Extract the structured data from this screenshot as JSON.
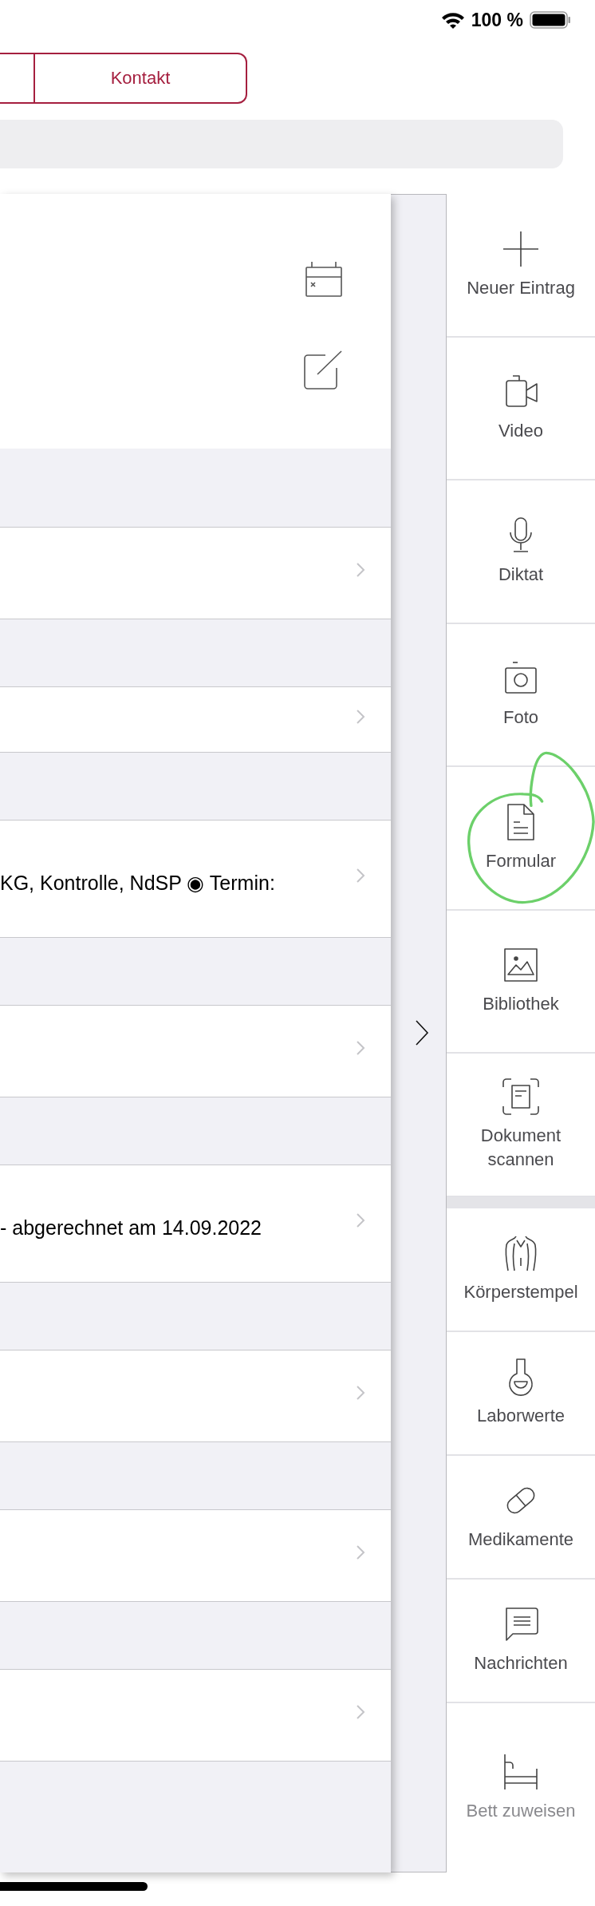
{
  "status_bar": {
    "battery_text": "100 %"
  },
  "segmented_control": {
    "segments": [
      {
        "label": "Kontakt",
        "selected": false
      }
    ]
  },
  "entries": [
    {
      "kind": "row"
    },
    {
      "kind": "row"
    },
    {
      "kind": "row",
      "text": "KG, Kontrolle, NdSP ◉ Termin:"
    },
    {
      "kind": "row"
    },
    {
      "kind": "row",
      "text": "- abgerechnet am 14.09.2022"
    },
    {
      "kind": "row"
    },
    {
      "kind": "row"
    },
    {
      "kind": "row"
    }
  ],
  "actions": {
    "groups": [
      [
        {
          "label": "Neuer Eintrag",
          "disabled": false
        },
        {
          "label": "Video",
          "disabled": false
        },
        {
          "label": "Diktat",
          "disabled": false
        },
        {
          "label": "Foto",
          "disabled": false
        },
        {
          "label": "Formular",
          "disabled": false
        },
        {
          "label": "Bibliothek",
          "disabled": false
        },
        {
          "label": "Dokument scannen",
          "disabled": false
        }
      ],
      [
        {
          "label": "Körperstempel",
          "disabled": false
        },
        {
          "label": "Laborwerte",
          "disabled": false
        },
        {
          "label": "Medikamente",
          "disabled": false
        },
        {
          "label": "Nachrichten",
          "disabled": false
        },
        {
          "label": "Bett zuweisen",
          "disabled": true
        }
      ]
    ]
  }
}
